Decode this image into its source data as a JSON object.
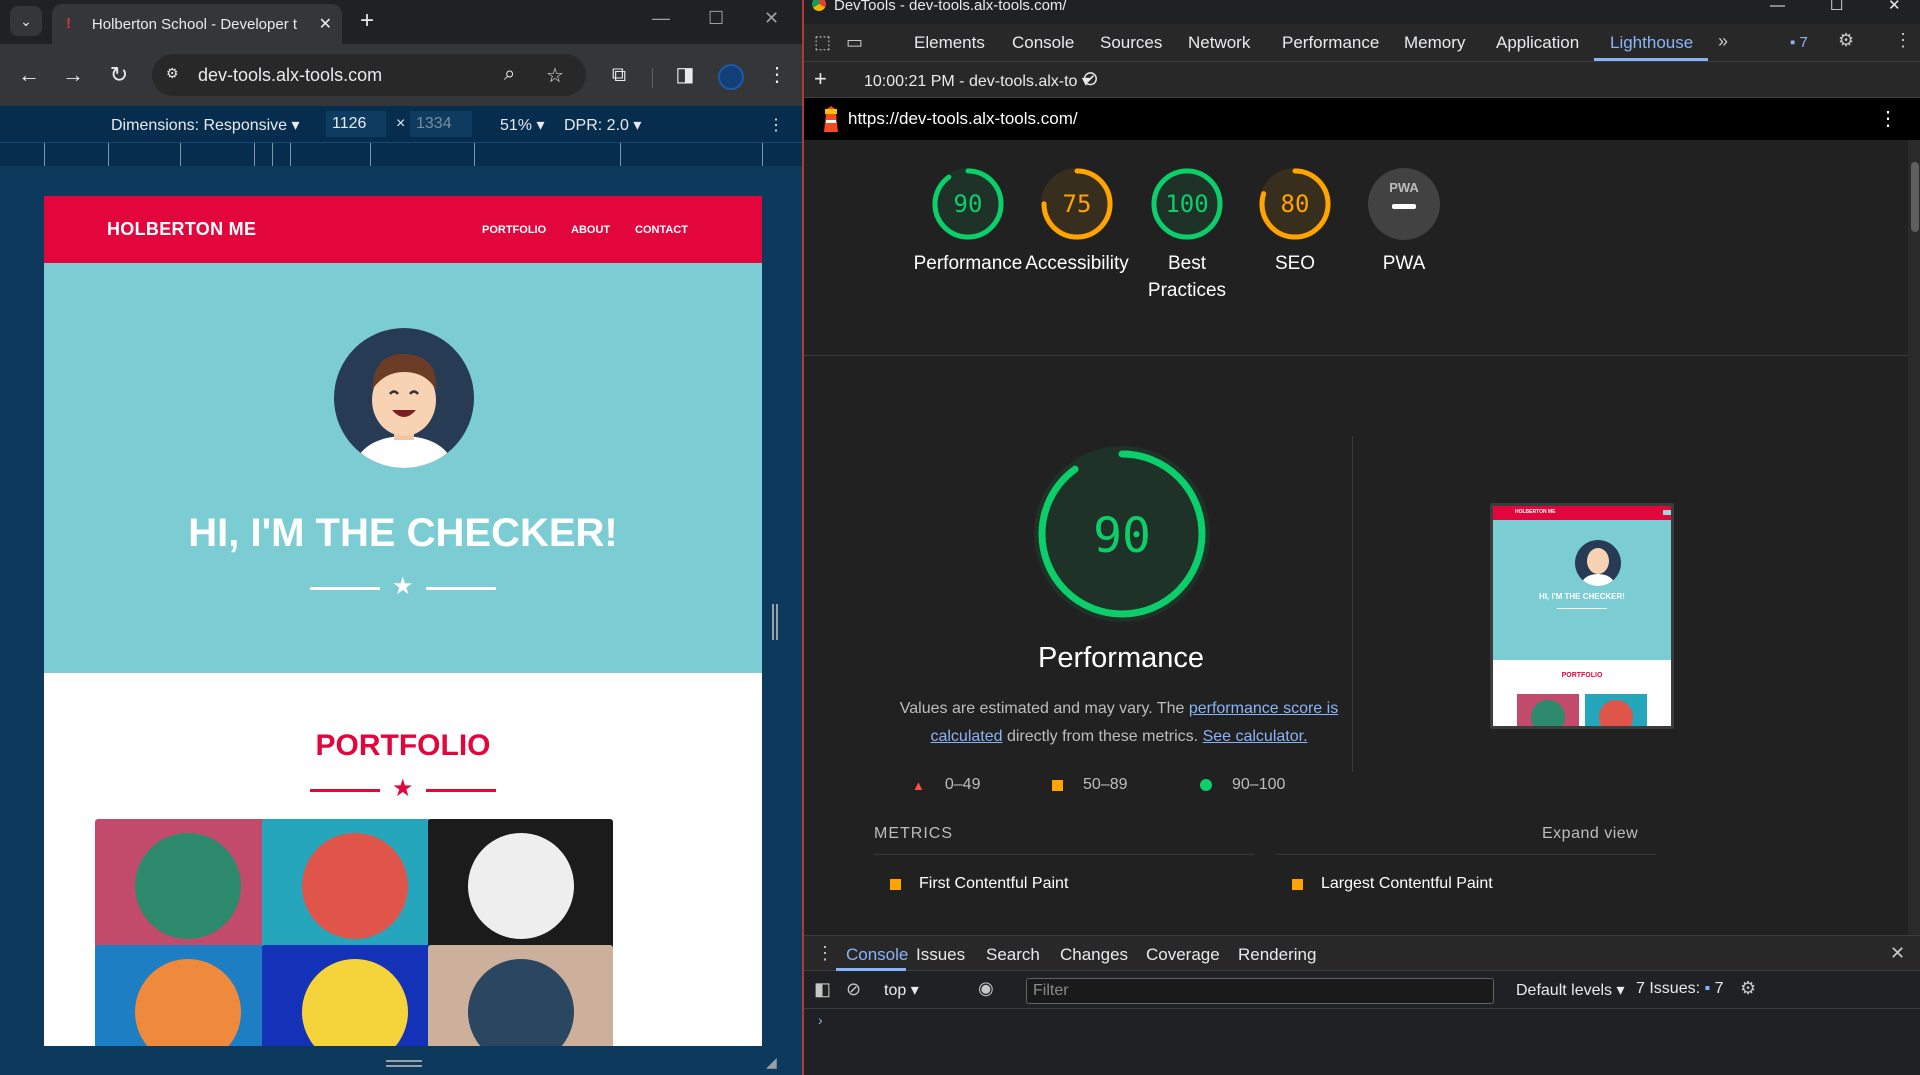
{
  "browser": {
    "tab_title": "Holberton School - Developer t",
    "address": "dev-tools.alx-tools.com",
    "emulation": {
      "dimensions_label": "Dimensions: Responsive",
      "width": "1126",
      "times": "×",
      "height": "1334",
      "zoom": "51%",
      "dpr": "DPR: 2.0"
    }
  },
  "site": {
    "brand": "HOLBERTON ME",
    "nav": [
      "PORTFOLIO",
      "ABOUT",
      "CONTACT"
    ],
    "hero_title": "HI, I'M THE CHECKER!",
    "portfolio_title": "PORTFOLIO",
    "colors": {
      "nav": "#e2063d",
      "hero": "#7bcdd3"
    },
    "portfolio_tiles": [
      {
        "icon": "cabin-icon",
        "bg": "#c24b6c",
        "circle": "#2e8a6d"
      },
      {
        "icon": "cake-icon",
        "bg": "#26a6bd",
        "circle": "#e0554a"
      },
      {
        "icon": "circus-tent-icon",
        "bg": "#1b1b1b",
        "circle": "#eeeeee"
      },
      {
        "icon": "game-controller-icon",
        "bg": "#1e7ec3",
        "circle": "#ef8a3c"
      },
      {
        "icon": "safe-icon",
        "bg": "#1432b8",
        "circle": "#f5d33b"
      },
      {
        "icon": "submarine-icon",
        "bg": "#ccb09c",
        "circle": "#2a4660"
      }
    ]
  },
  "devtools": {
    "window_title": "DevTools - dev-tools.alx-tools.com/",
    "tabs": [
      "Elements",
      "Console",
      "Sources",
      "Network",
      "Performance",
      "Memory",
      "Application",
      "Lighthouse"
    ],
    "active_tab": "Lighthouse",
    "issues_count": "7",
    "report_time": "10:00:21 PM - dev-tools.alx-to",
    "report_url": "https://dev-tools.alx-tools.com/",
    "gauges": [
      {
        "score": "90",
        "label": "Performance",
        "value": 0.9,
        "color": "#0cce6b"
      },
      {
        "score": "75",
        "label": "Accessibility",
        "value": 0.75,
        "color": "#ffa400"
      },
      {
        "score": "100",
        "label": "Best Practices",
        "value": 1.0,
        "color": "#0cce6b"
      },
      {
        "score": "80",
        "label": "SEO",
        "value": 0.8,
        "color": "#ffa400"
      },
      {
        "score": "PWA",
        "label": "PWA",
        "value": 0,
        "color": "#9e9e9e"
      }
    ],
    "main": {
      "score": "90",
      "label": "Performance",
      "desc_prefix": "Values are estimated and may vary. The ",
      "desc_link1": "performance score is calculated",
      "desc_mid": " directly from these metrics. ",
      "desc_link2": "See calculator.",
      "legend": [
        "0–49",
        "50–89",
        "90–100"
      ],
      "metrics_heading": "METRICS",
      "expand": "Expand view",
      "metrics": [
        "First Contentful Paint",
        "Largest Contentful Paint"
      ]
    },
    "thumbnail": {
      "brand": "HOLBERTON ME",
      "title": "HI, I'M THE CHECKER!",
      "portfolio": "PORTFOLIO"
    },
    "drawer": {
      "tabs": [
        "Console",
        "Issues",
        "Search",
        "Changes",
        "Coverage",
        "Rendering"
      ],
      "context": "top",
      "filter_placeholder": "Filter",
      "levels": "Default levels",
      "issues": "7 Issues:",
      "issues_count": "7"
    }
  }
}
